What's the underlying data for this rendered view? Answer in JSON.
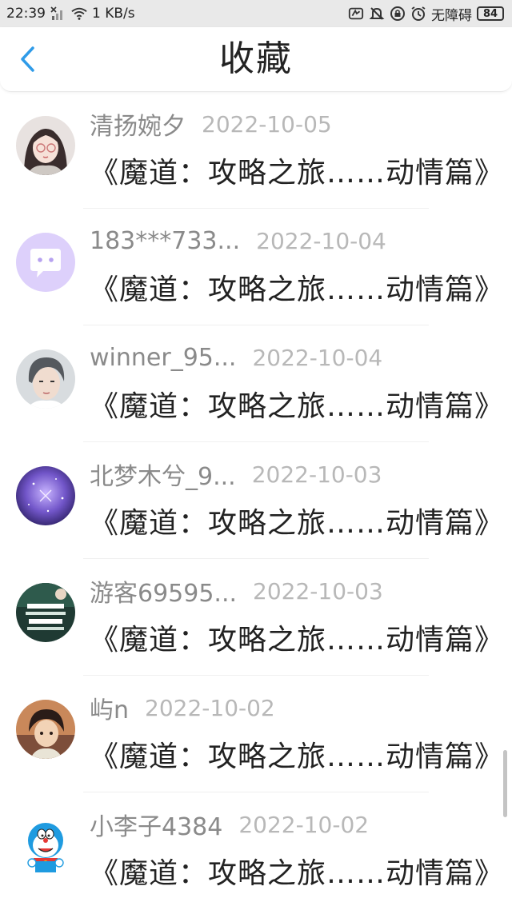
{
  "status_bar": {
    "time": "22:39",
    "network_speed": "1 KB/s",
    "accessibility_text": "无障碍",
    "battery": "84"
  },
  "header": {
    "title": "收藏",
    "back_icon": "chevron-left-icon"
  },
  "accent_color": "#2f9be8",
  "items": [
    {
      "user": "清扬婉夕",
      "date": "2022-10-05",
      "title": "《魔道：攻略之旅……动情篇》",
      "avatar": "anime-girl-glasses"
    },
    {
      "user": "183***733...",
      "date": "2022-10-04",
      "title": "《魔道：攻略之旅……动情篇》",
      "avatar": "chat-bubble-default"
    },
    {
      "user": "winner_95...",
      "date": "2022-10-04",
      "title": "《魔道：攻略之旅……动情篇》",
      "avatar": "young-man-portrait"
    },
    {
      "user": "北梦木兮_9...",
      "date": "2022-10-03",
      "title": "《魔道：攻略之旅……动情篇》",
      "avatar": "purple-galaxy"
    },
    {
      "user": "游客69595...",
      "date": "2022-10-03",
      "title": "《魔道：攻略之旅……动情篇》",
      "avatar": "green-text-poster"
    },
    {
      "user": "屿n",
      "date": "2022-10-02",
      "title": "《魔道：攻略之旅……动情篇》",
      "avatar": "anime-boy-sunset"
    },
    {
      "user": "小李子4384",
      "date": "2022-10-02",
      "title": "《魔道：攻略之旅……动情篇》",
      "avatar": "doraemon"
    }
  ]
}
